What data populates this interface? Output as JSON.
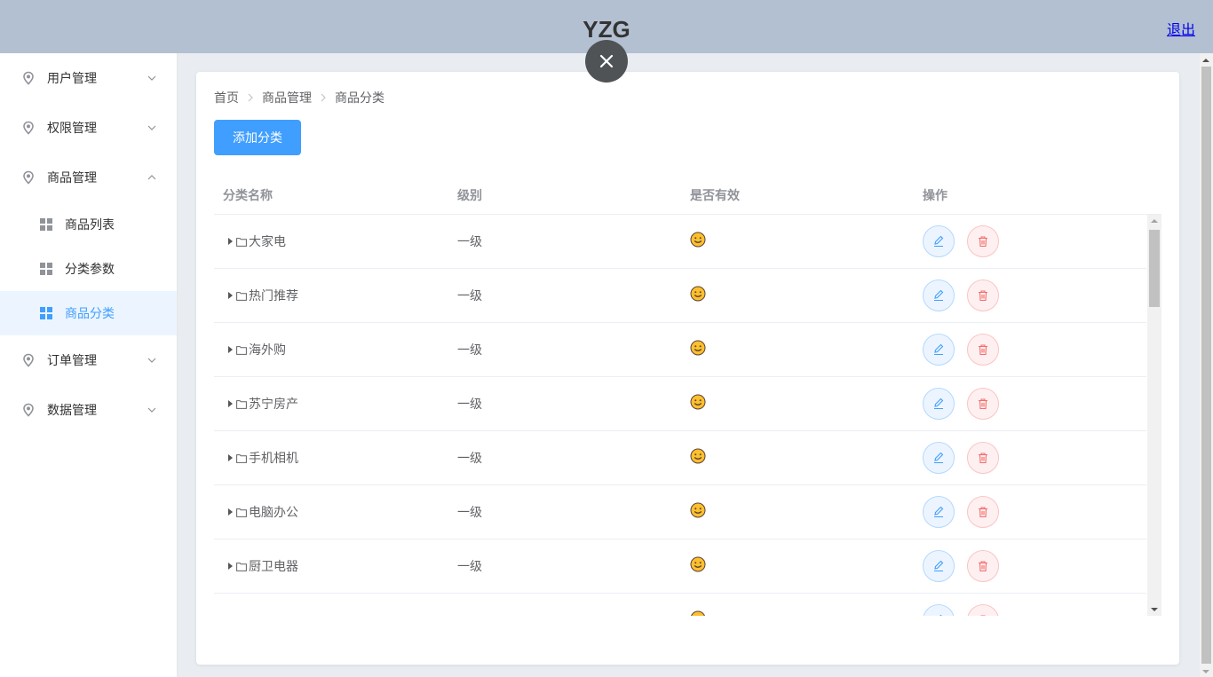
{
  "header": {
    "title": "YZG",
    "logout": "退出"
  },
  "sidebar": {
    "menus": [
      {
        "label": "用户管理"
      },
      {
        "label": "权限管理"
      },
      {
        "label": "商品管理"
      },
      {
        "label": "订单管理"
      },
      {
        "label": "数据管理"
      }
    ],
    "sub_items": [
      {
        "label": "商品列表"
      },
      {
        "label": "分类参数"
      },
      {
        "label": "商品分类"
      }
    ]
  },
  "breadcrumb": [
    "首页",
    "商品管理",
    "商品分类"
  ],
  "add_button": "添加分类",
  "table": {
    "headers": [
      "分类名称",
      "级别",
      "是否有效",
      "操作"
    ],
    "rows": [
      {
        "name": "大家电",
        "level": "一级"
      },
      {
        "name": "热门推荐",
        "level": "一级"
      },
      {
        "name": "海外购",
        "level": "一级"
      },
      {
        "name": "苏宁房产",
        "level": "一级"
      },
      {
        "name": "手机相机",
        "level": "一级"
      },
      {
        "name": "电脑办公",
        "level": "一级"
      },
      {
        "name": "厨卫电器",
        "level": "一级"
      },
      {
        "name": "",
        "level": ""
      }
    ]
  },
  "colors": {
    "primary": "#409eff",
    "danger": "#f56c6c",
    "header_bg": "#b3c0d1"
  },
  "icons": [
    "location-icon",
    "chevron-down-icon",
    "chevron-up-icon",
    "grid-icon",
    "close-icon",
    "folder-icon",
    "smile-icon",
    "edit-icon",
    "delete-icon"
  ]
}
